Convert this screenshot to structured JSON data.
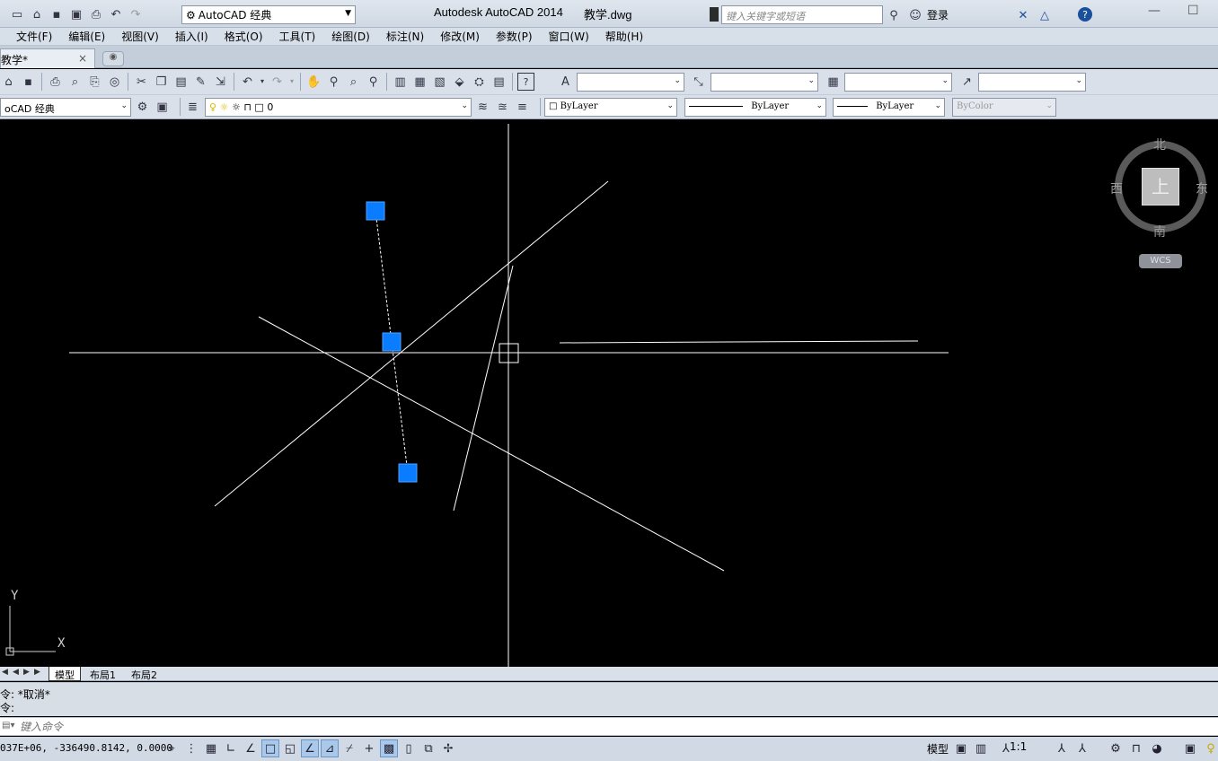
{
  "titlebar": {
    "workspace": "AutoCAD 经典",
    "app_title": "Autodesk AutoCAD 2014",
    "doc_title": "教学.dwg",
    "search_placeholder": "键入关键字或短语",
    "login": "登录"
  },
  "menu": [
    "文件(F)",
    "编辑(E)",
    "视图(V)",
    "插入(I)",
    "格式(O)",
    "工具(T)",
    "绘图(D)",
    "标注(N)",
    "修改(M)",
    "参数(P)",
    "窗口(W)",
    "帮助(H)"
  ],
  "tabs": {
    "doc_tab": "教学*",
    "close": "×"
  },
  "toolbar2": {
    "workspace": "oCAD 经典",
    "layer": "0",
    "color": "ByLayer",
    "linetype": "ByLayer",
    "lineweight": "ByLayer",
    "plotstyle": "ByColor"
  },
  "viewcube": {
    "north": "北",
    "south": "南",
    "east": "东",
    "west": "西",
    "top": "上",
    "wcs": "WCS"
  },
  "ucs": {
    "x": "X",
    "y": "Y"
  },
  "layout_tabs": [
    "模型",
    "布局1",
    "布局2"
  ],
  "command": {
    "history": [
      "令: *取消*",
      "令:"
    ],
    "placeholder": "键入命令"
  },
  "status": {
    "coords": "037E+06, -336490.8142, 0.0000",
    "model": "模型",
    "scale": "1:1"
  },
  "colors": {
    "canvas": "#000000",
    "grip": "#0a7cff",
    "geometry": "#ffffff"
  }
}
